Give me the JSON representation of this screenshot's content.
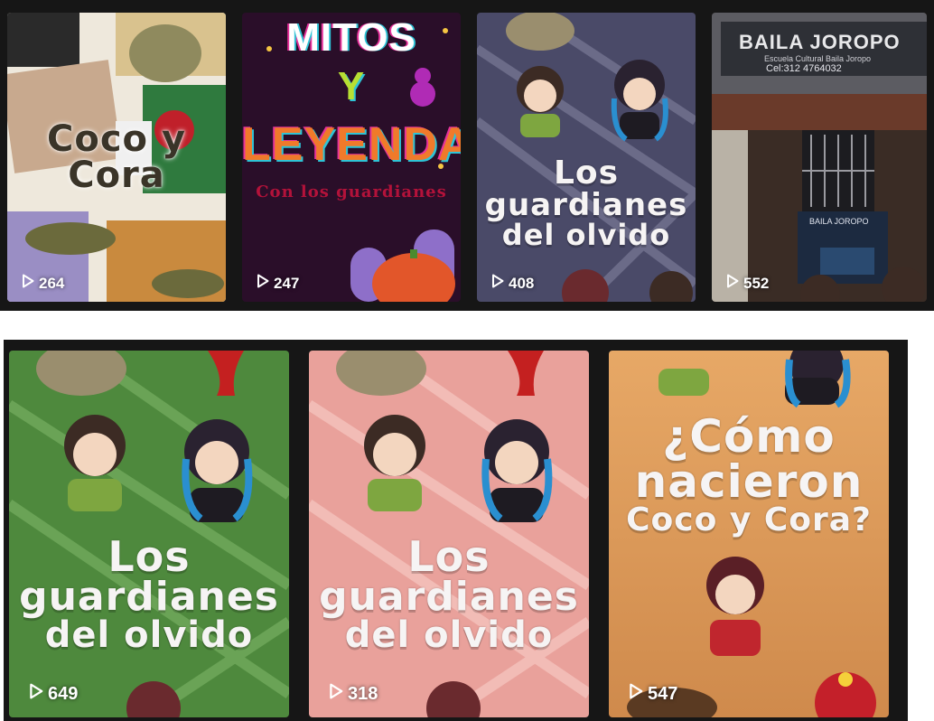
{
  "cards": [
    {
      "title_lines": [
        "Coco y",
        "Cora"
      ],
      "views": "264",
      "bg": "#efe9dd",
      "accent": "#3d3a33"
    },
    {
      "title_lines": [
        "MITOS",
        "Y",
        "LEYENDAS"
      ],
      "subtitle": "Con los guardianes",
      "views": "247",
      "bg": "#2b0f2a",
      "accent": "#c8248a"
    },
    {
      "title_lines": [
        "Los",
        "guardianes",
        "del olvido"
      ],
      "views": "408",
      "bg": "#4b4b6a"
    },
    {
      "sign_text": "BAILA JOROPO",
      "sign_sub": "Escuela Cultural Baila Joropo",
      "sign_phone": "Cel:312 4764032",
      "views": "552",
      "bg": "#3a2b24"
    },
    {
      "title_lines": [
        "Los",
        "guardianes",
        "del olvido"
      ],
      "views": "649",
      "bg": "#4f8a3e"
    },
    {
      "title_lines": [
        "Los",
        "guardianes",
        "del olvido"
      ],
      "views": "318",
      "bg": "#e9a29c"
    },
    {
      "title_lines": [
        "¿Cómo",
        "nacieron",
        "Coco y Cora?"
      ],
      "views": "547",
      "bg": "#e2a05c"
    }
  ]
}
